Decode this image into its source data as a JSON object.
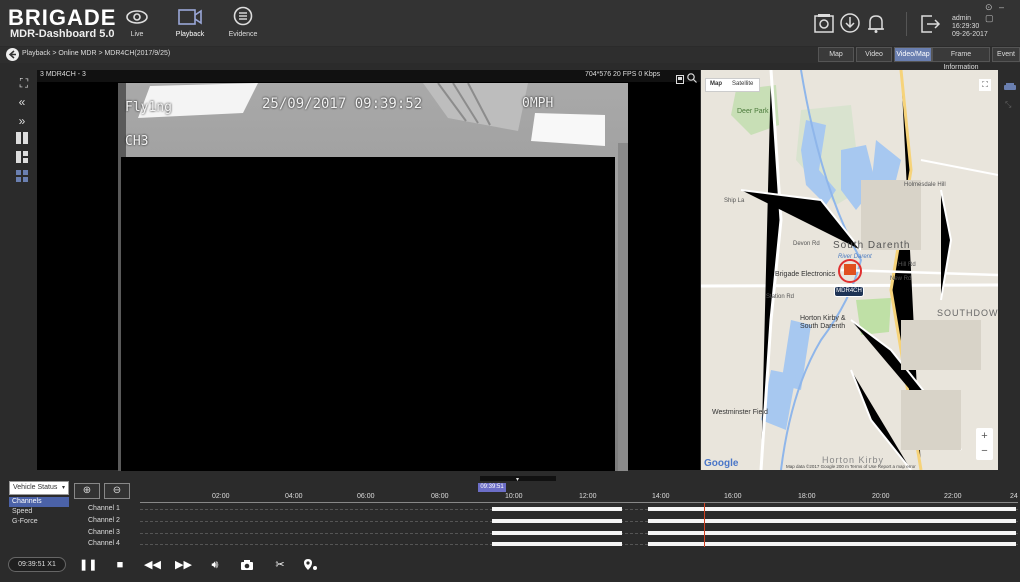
{
  "app": {
    "brand": "BRIGADE",
    "subtitle": "MDR-Dashboard 5.0"
  },
  "nav": [
    {
      "label": "Live",
      "icon": "eye-icon"
    },
    {
      "label": "Playback",
      "icon": "video-camera-icon"
    },
    {
      "label": "Evidence",
      "icon": "chat-list-icon"
    }
  ],
  "topicons": [
    "settings-doc-icon",
    "download-icon",
    "bell-icon",
    "logout-icon"
  ],
  "user": {
    "name": "admin",
    "time": "16:29:30",
    "date": "09-26-2017"
  },
  "breadcrumb": "Playback > Online MDR > MDR4CH(2017/9/25)",
  "view_tabs": [
    "Map",
    "Video",
    "Video/Map",
    "Frame Information",
    "Event"
  ],
  "active_view_tab": "Video/Map",
  "video": {
    "label": "3 MDR4CH - 3",
    "stats": "704*576   20 FPS   0 Kbps",
    "osd_name": "Fly1ng",
    "osd_datetime": "25/09/2017  09:39:52",
    "osd_speed": "0MPH",
    "osd_channel": "CH3"
  },
  "map": {
    "toggle": [
      "Map",
      "Satellite"
    ],
    "places": [
      "Deer Park",
      "Holmesdale Hill",
      "Devon Rd",
      "South Darenth",
      "River Darent",
      "Brigade Electronics",
      "MDR4CH",
      "Station Rd",
      "Horton Kirby & South Darenth",
      "SOUTHDOWN",
      "Westminster Field",
      "Horton Kirby",
      "New Rd",
      "Ship La",
      "Hill Rd"
    ],
    "marker_label": "MDR4CH",
    "google": "Google",
    "attribution": "Map data ©2017 Google   200 m      Terms of Use   Report a map error",
    "zoom_in": "+",
    "zoom_out": "−"
  },
  "timeline": {
    "select_value": "Vehicle Status",
    "status_items": [
      "Channels",
      "Speed",
      "G-Force"
    ],
    "selected_status": "Channels",
    "cursor_time": "09:39:51",
    "ticks": [
      "02:00",
      "04:00",
      "06:00",
      "08:00",
      "10:00",
      "12:00",
      "14:00",
      "16:00",
      "18:00",
      "20:00",
      "22:00",
      "24"
    ],
    "channels": [
      "Channel 1",
      "Channel 2",
      "Channel 3",
      "Channel 4"
    ]
  },
  "playback": {
    "time": "09:39:51  X1"
  }
}
